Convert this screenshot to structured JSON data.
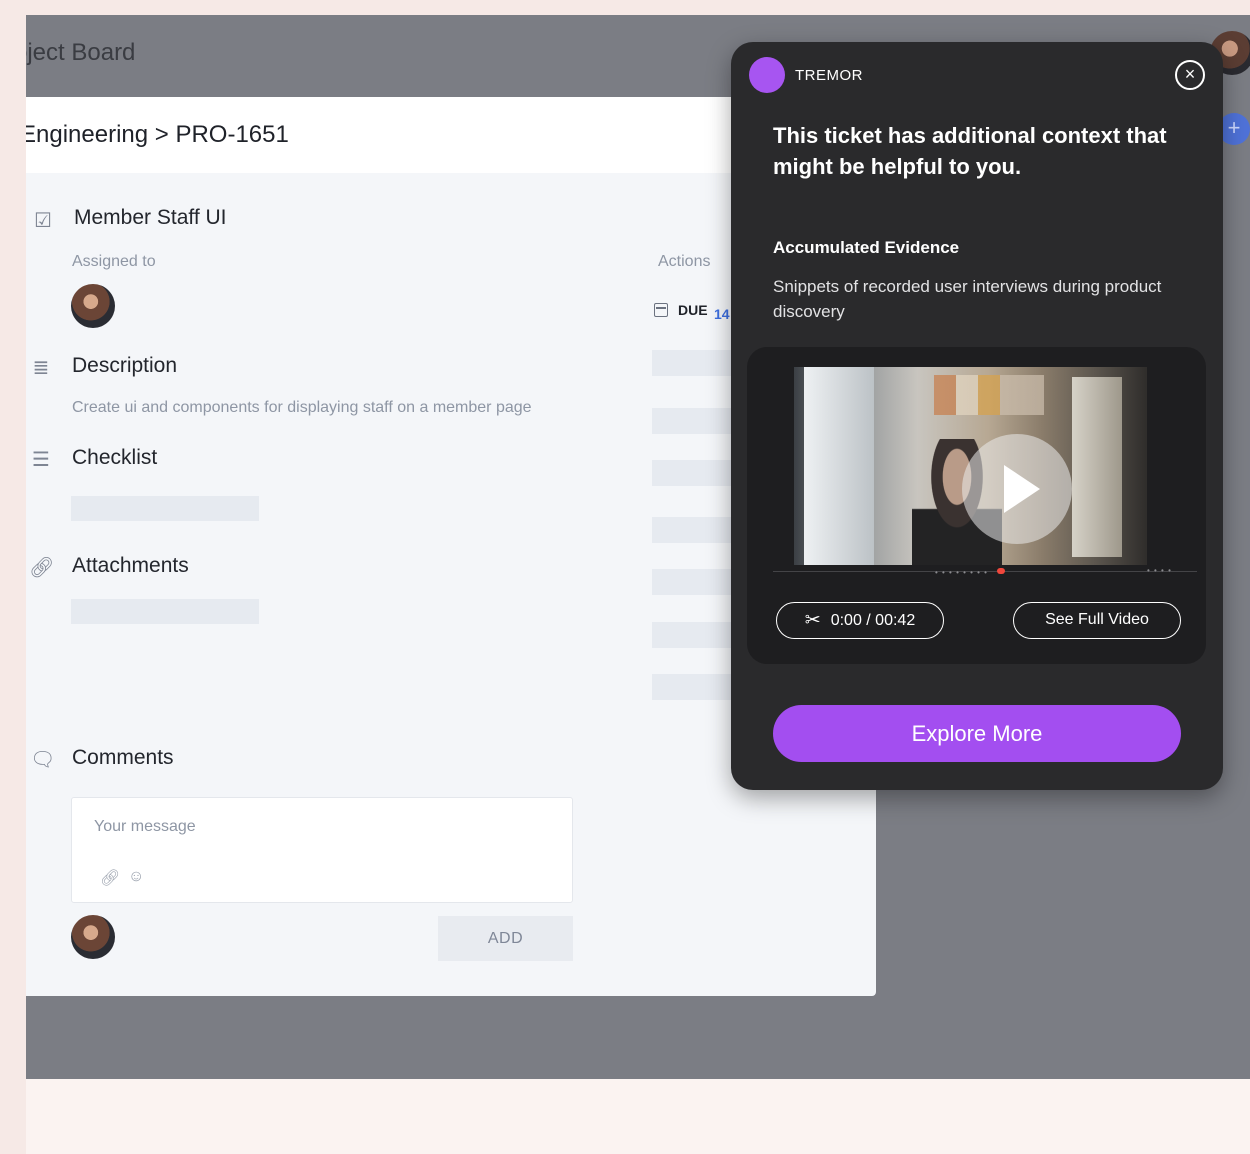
{
  "board": {
    "title": "oject Board"
  },
  "modal": {
    "breadcrumb": "Engineering > PRO-1651",
    "task_title": "Member Staff UI",
    "assigned_label": "Assigned to",
    "actions_label": "Actions",
    "due_label": "DUE",
    "due_date": "14",
    "description_title": "Description",
    "description_text": "Create ui and components for displaying staff on a member page",
    "checklist_title": "Checklist",
    "attachments_title": "Attachments",
    "comments_title": "Comments",
    "comment_placeholder": "Your message",
    "add_label": "ADD"
  },
  "icons": {
    "task": "checkbox-icon",
    "description": "align-left-icon",
    "checklist": "list-check-icon",
    "attachments": "link-icon",
    "comments": "chat-bubble-icon",
    "calendar": "calendar-icon",
    "attach": "link-icon",
    "emoji": "smile-icon",
    "close": "close-icon",
    "scissors": "scissors-icon",
    "play": "play-icon"
  },
  "tremor": {
    "brand": "TREMOR",
    "headline": "This ticket has additional context that might be helpful to you.",
    "evidence_title": "Accumulated Evidence",
    "evidence_desc": "Snippets of recorded user interviews during product discovery",
    "time": "0:00 / 00:42",
    "full_video_label": "See Full Video",
    "explore_label": "Explore More",
    "accent_color": "#a34ef0"
  }
}
